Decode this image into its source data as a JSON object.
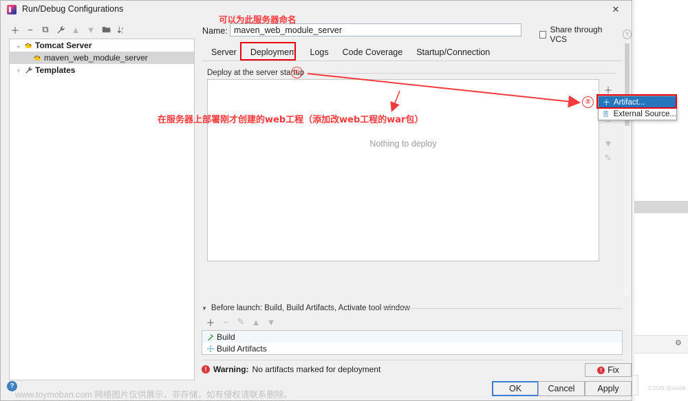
{
  "window": {
    "title": "Run/Debug Configurations",
    "close_label": "✕",
    "app_icon": "intellij-idea-icon"
  },
  "tree_toolbar": [
    {
      "name": "add-configuration-button",
      "glyph": "＋",
      "dim": false
    },
    {
      "name": "remove-configuration-button",
      "glyph": "−",
      "dim": false
    },
    {
      "name": "copy-configuration-button",
      "glyph": "⧉",
      "dim": false
    },
    {
      "name": "edit-templates-button",
      "glyph": "🔧",
      "dim": false
    },
    {
      "name": "move-up-button",
      "glyph": "▲",
      "dim": true
    },
    {
      "name": "move-down-button",
      "glyph": "▼",
      "dim": true
    },
    {
      "name": "new-folder-button",
      "glyph": "🗀",
      "dim": false
    },
    {
      "name": "sort-configurations-button",
      "glyph": "↓ₓ",
      "dim": false
    }
  ],
  "tree": [
    {
      "label": "Tomcat Server",
      "twisty": "⌄",
      "icon": "tomcat-icon",
      "bold": true,
      "indent": 0,
      "selected": false
    },
    {
      "label": "maven_web_module_server",
      "twisty": "",
      "icon": "tomcat-icon",
      "bold": false,
      "indent": 1,
      "selected": true
    },
    {
      "label": "Templates",
      "twisty": "›",
      "icon": "wrench-icon",
      "bold": true,
      "indent": 0,
      "selected": false
    }
  ],
  "name_field": {
    "label": "Name:",
    "value": "maven_web_module_server",
    "placeholder": "Name"
  },
  "share_vcs": {
    "label": "Share through VCS",
    "checked": false,
    "help_glyph": "?"
  },
  "tabs": [
    {
      "label": "Server",
      "active": false
    },
    {
      "label": "Deployment",
      "active": true
    },
    {
      "label": "Logs",
      "active": false
    },
    {
      "label": "Code Coverage",
      "active": false
    },
    {
      "label": "Startup/Connection",
      "active": false
    }
  ],
  "deploy": {
    "section_label": "Deploy at the server startup",
    "empty_text": "Nothing to deploy",
    "toolbar": [
      {
        "name": "add-artifact-button",
        "glyph": "＋",
        "dim": false
      },
      {
        "name": "remove-artifact-button",
        "glyph": "−",
        "dim": true
      },
      {
        "name": "move-down-artifact-button",
        "glyph": "▼",
        "dim": true
      },
      {
        "name": "edit-artifact-button",
        "glyph": "✎",
        "dim": true
      }
    ]
  },
  "popup_menu": {
    "items": [
      {
        "label": "Artifact...",
        "icon": "artifact-icon",
        "selected": true
      },
      {
        "label": "External Source...",
        "icon": "external-source-icon",
        "selected": false
      }
    ]
  },
  "before_launch": {
    "caret": "▼",
    "header": "Before launch: Build, Build Artifacts, Activate tool window",
    "toolbar": [
      {
        "name": "add-task-button",
        "glyph": "＋",
        "dim": false
      },
      {
        "name": "remove-task-button",
        "glyph": "−",
        "dim": true
      },
      {
        "name": "edit-task-button",
        "glyph": "✎",
        "dim": true
      },
      {
        "name": "task-move-up-button",
        "glyph": "▲",
        "dim": true
      },
      {
        "name": "task-move-down-button",
        "glyph": "▼",
        "dim": true
      }
    ],
    "rows": [
      {
        "label": "Build",
        "icon": "hammer-icon"
      },
      {
        "label": "Build Artifacts",
        "icon": "artifact-icon"
      }
    ]
  },
  "warning": {
    "icon_glyph": "!",
    "prefix": "Warning:",
    "message": "No artifacts marked for deployment",
    "fix_label": "Fix"
  },
  "buttons": {
    "ok": "OK",
    "cancel": "Cancel",
    "apply": "Apply"
  },
  "annotations": {
    "top_note": "可以为此服务器命名",
    "mid_note": "在服务器上部署刚才创建的web工程（添加改web工程的war包）",
    "marker_one": "①",
    "marker_two": "②",
    "accent_color": "#f5393c"
  },
  "watermarks": {
    "bottom": "www.toymoban.com 网络图片仅供展示，非存储，如有侵权请联系删除。",
    "bottom_badge": "?",
    "corner": "CSDN @siaok"
  },
  "background": {
    "gear_glyph": "⚙"
  }
}
